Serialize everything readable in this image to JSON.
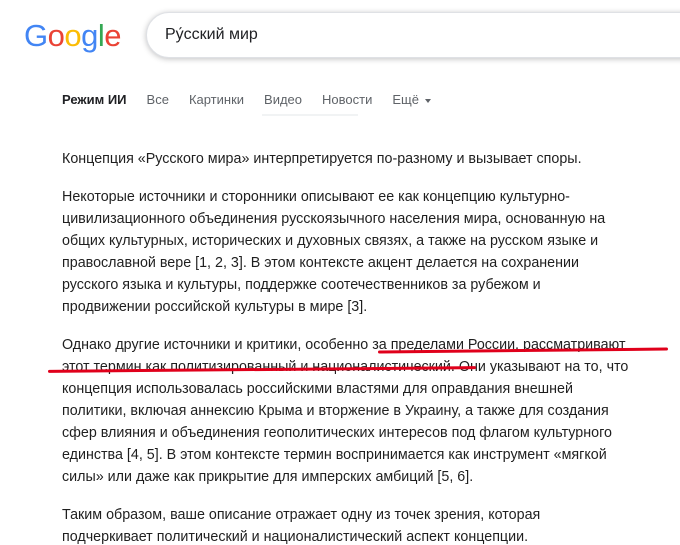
{
  "logo": {
    "text": "Google",
    "letters": [
      {
        "char": "G",
        "color": "#4285F4"
      },
      {
        "char": "o",
        "color": "#EA4335"
      },
      {
        "char": "o",
        "color": "#FBBC05"
      },
      {
        "char": "g",
        "color": "#4285F4"
      },
      {
        "char": "l",
        "color": "#34A853"
      },
      {
        "char": "e",
        "color": "#EA4335"
      }
    ]
  },
  "search": {
    "query": "Ру́сский мир"
  },
  "tabs": [
    {
      "label": "Режим ИИ",
      "active": true
    },
    {
      "label": "Все",
      "active": false
    },
    {
      "label": "Картинки",
      "active": false
    },
    {
      "label": "Видео",
      "active": false
    },
    {
      "label": "Новости",
      "active": false
    },
    {
      "label": "Ещё",
      "active": false
    }
  ],
  "answer": {
    "p1": [
      "Концепция «Русского мира» интерпретируется по-разному и вызывает споры."
    ],
    "p2": [
      "Некоторые источники и сторонники описывают ее как концепцию культурно-",
      "цивилизационного объединения русскоязычного населения мира, основанную на",
      "общих культурных, исторических и духовных связях, а также на русском языке и",
      "православной вере [1, 2, 3]. В этом контексте акцент делается на сохранении",
      "русского языка и культуры, поддержке соотечественников за рубежом и",
      "продвижении российской культуры в мире [3]."
    ],
    "p3": [
      "Однако другие источники и критики, особенно за пределами России, рассматривают",
      "этот термин как политизированный и националистический. Они указывают на то, что",
      "концепция использовалась российскими властями для оправдания внешней",
      "политики, включая аннексию Крыма и вторжение в Украину, а также для создания",
      "сфер влияния и объединения геополитических интересов под флагом культурного",
      "единства [4, 5]. В этом контексте термин воспринимается как инструмент «мягкой",
      "силы» или даже как прикрытие для имперских амбиций [5, 6]."
    ],
    "p4": [
      "Таким образом, ваше описание отражает одну из точек зрения, которая",
      "подчеркивает политический и националистический аспект концепции."
    ]
  },
  "annotation": {
    "color": "#e0001b"
  }
}
